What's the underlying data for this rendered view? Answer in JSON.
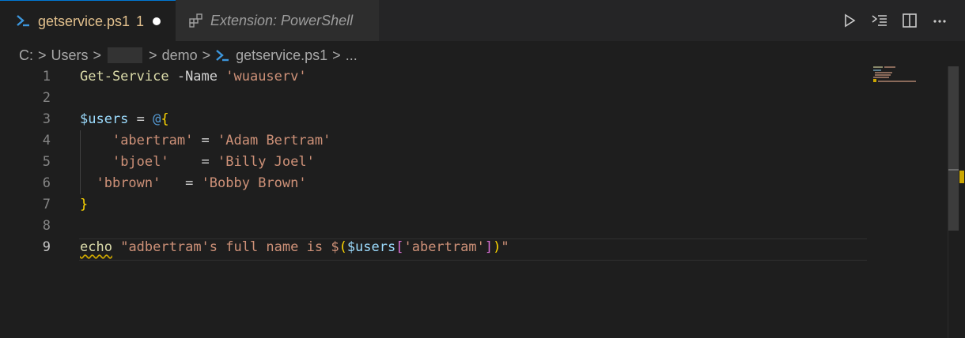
{
  "tabs": [
    {
      "label": "getservice.ps1",
      "badge": "1",
      "icon": "powershell-icon",
      "modified": true,
      "active": true
    },
    {
      "label": "Extension: PowerShell",
      "icon": "extension-icon",
      "italic": true,
      "active": false
    }
  ],
  "actions": [
    {
      "icon": "run-icon"
    },
    {
      "icon": "run-selection-icon"
    },
    {
      "icon": "split-editor-icon"
    },
    {
      "icon": "more-actions-icon"
    }
  ],
  "breadcrumb": {
    "items": [
      "C:",
      "Users",
      "demo",
      "getservice.ps1",
      "..."
    ],
    "sep": ">"
  },
  "editor": {
    "current_line": 9,
    "line_numbers": [
      "1",
      "2",
      "3",
      "4",
      "5",
      "6",
      "7",
      "8",
      "9"
    ],
    "lines": [
      {
        "tokens": [
          [
            "Get-Service",
            "fn"
          ],
          [
            " -Name ",
            "param"
          ],
          [
            "'wuauserv'",
            "str"
          ]
        ]
      },
      {
        "tokens": []
      },
      {
        "tokens": [
          [
            "$users",
            "var"
          ],
          [
            " = ",
            "op"
          ],
          [
            "@",
            "at"
          ],
          [
            "{",
            "br1"
          ]
        ]
      },
      {
        "tokens": [
          [
            "    ",
            "op"
          ],
          [
            "'abertram'",
            "str"
          ],
          [
            " = ",
            "op"
          ],
          [
            "'Adam Bertram'",
            "str"
          ]
        ]
      },
      {
        "tokens": [
          [
            "    ",
            "op"
          ],
          [
            "'bjoel'",
            "str"
          ],
          [
            "    = ",
            "op"
          ],
          [
            "'Billy Joel'",
            "str"
          ]
        ]
      },
      {
        "tokens": [
          [
            "  ",
            "op"
          ],
          [
            "'bbrown'",
            "str"
          ],
          [
            "   = ",
            "op"
          ],
          [
            "'Bobby Brown'",
            "str"
          ]
        ]
      },
      {
        "tokens": [
          [
            "}",
            "br1"
          ]
        ]
      },
      {
        "tokens": []
      },
      {
        "tokens": [
          [
            "echo",
            "fn squig"
          ],
          [
            " ",
            "op"
          ],
          [
            "\"adbertram's full name is ",
            "str"
          ],
          [
            "$",
            "str"
          ],
          [
            "(",
            "br1"
          ],
          [
            "$users",
            "var"
          ],
          [
            "[",
            "br2"
          ],
          [
            "'abertram'",
            "str"
          ],
          [
            "]",
            "br2"
          ],
          [
            ")",
            "br1"
          ],
          [
            "\"",
            "str"
          ]
        ]
      }
    ]
  },
  "colors": {
    "accent": "#0078d4",
    "modified_tab_text": "#e2c08d",
    "warning": "#cca700"
  }
}
